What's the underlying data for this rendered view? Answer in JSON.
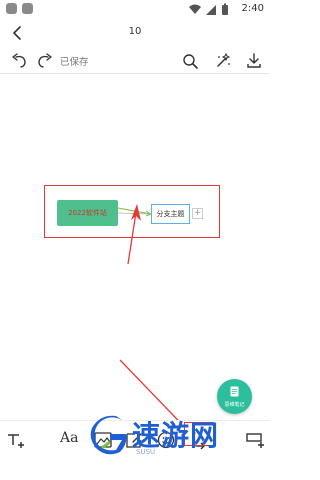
{
  "status_bar": {
    "time": "2:40"
  },
  "header": {
    "title": "10"
  },
  "toolbar": {
    "saved_label": "已保存"
  },
  "mindmap": {
    "central_topic": "2022软件站",
    "branch_topic": "分支主题",
    "add_child_symbol": "+"
  },
  "fab": {
    "label": "思维笔记"
  },
  "bottom_bar": {
    "text_style_glyph": "Aa",
    "tools": [
      "add-sibling-topic",
      "text-style",
      "image",
      "edit",
      "emoji",
      "connect-line",
      "add-child-topic"
    ]
  },
  "watermark": {
    "brand": "速游网",
    "domain": "SUSU"
  },
  "colors": {
    "central_node": "#4fc08d",
    "branch_border": "#5ab0e8",
    "annotation": "#e53935",
    "fab": "#2dbf9d",
    "watermark": "#1e5fd6"
  }
}
